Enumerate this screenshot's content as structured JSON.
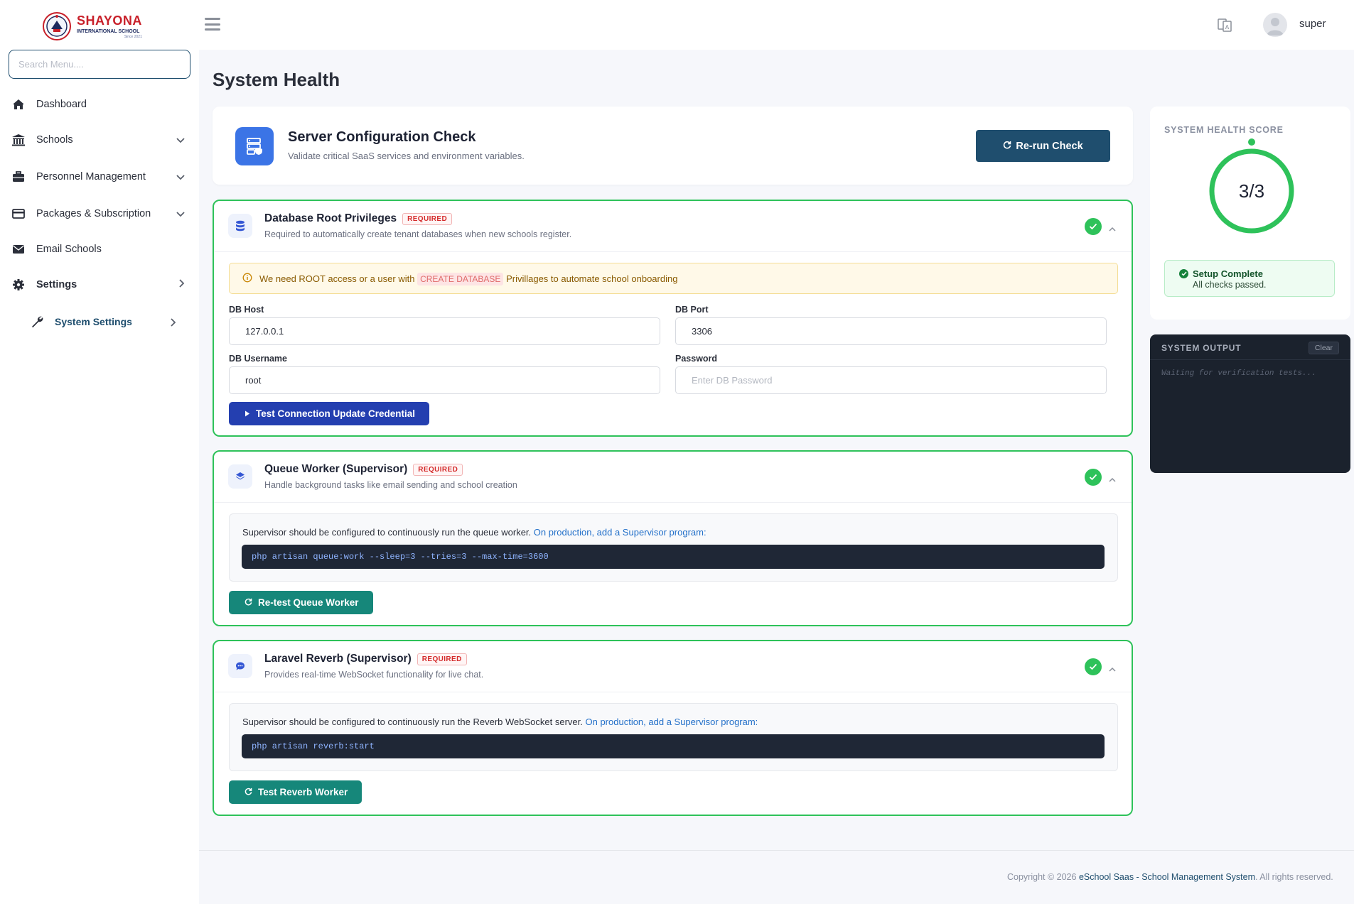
{
  "brand": {
    "name": "SHAYONA",
    "subtitle": "INTERNATIONAL SCHOOL",
    "tagline": "Since 2021"
  },
  "sidebar": {
    "search_placeholder": "Search Menu....",
    "items": [
      {
        "label": "Dashboard"
      },
      {
        "label": "Schools"
      },
      {
        "label": "Personnel Management"
      },
      {
        "label": "Packages & Subscription"
      },
      {
        "label": "Email Schools"
      },
      {
        "label": "Settings"
      },
      {
        "label": "System Settings"
      }
    ]
  },
  "topbar": {
    "username": "super"
  },
  "page": {
    "title": "System Health"
  },
  "hero": {
    "title": "Server Configuration Check",
    "subtitle": "Validate critical SaaS services and environment variables.",
    "button": "Re-run Check"
  },
  "db_card": {
    "title": "Database Root Privileges",
    "badge": "REQUIRED",
    "subtitle": "Required to automatically create tenant databases when new schools register.",
    "warning_pre": "We need ROOT access or a user with",
    "warning_code": "CREATE DATABASE",
    "warning_post": "Privillages to automate school onboarding",
    "host_label": "DB Host",
    "host_value": "127.0.0.1",
    "port_label": "DB Port",
    "port_value": "3306",
    "username_label": "DB Username",
    "username_value": "root",
    "password_label": "Password",
    "password_placeholder": "Enter DB Password",
    "button": "Test Connection Update Credential"
  },
  "queue_card": {
    "title": "Queue Worker (Supervisor)",
    "badge": "REQUIRED",
    "subtitle": "Handle background tasks like email sending and school creation",
    "info": "Supervisor should be configured to continuously run the queue worker.",
    "info_link": "On production, add a Supervisor program:",
    "command": "php artisan queue:work --sleep=3 --tries=3 --max-time=3600",
    "button": "Re-test Queue Worker"
  },
  "reverb_card": {
    "title": "Laravel Reverb (Supervisor)",
    "badge": "REQUIRED",
    "subtitle": "Provides real-time WebSocket functionality for live chat.",
    "info": "Supervisor should be configured to continuously run the Reverb WebSocket server.",
    "info_link": "On production, add a Supervisor program:",
    "command": "php artisan reverb:start",
    "button": "Test Reverb Worker"
  },
  "score": {
    "label": "SYSTEM HEALTH SCORE",
    "value": "3/3",
    "passed": 3,
    "total": 3,
    "status_title": "Setup Complete",
    "status_sub": "All checks passed."
  },
  "output": {
    "title": "SYSTEM OUTPUT",
    "clear": "Clear",
    "text": "Waiting for verification tests..."
  },
  "footer": {
    "prefix": "Copyright © 2026",
    "brand": "eSchool Saas - School Management System",
    "suffix": ". All rights reserved."
  },
  "colors": {
    "primary": "#1f4e6e",
    "success": "#2ec25a",
    "blue_button": "#243fb0",
    "teal_button": "#16877a",
    "danger": "#d42a2a"
  }
}
